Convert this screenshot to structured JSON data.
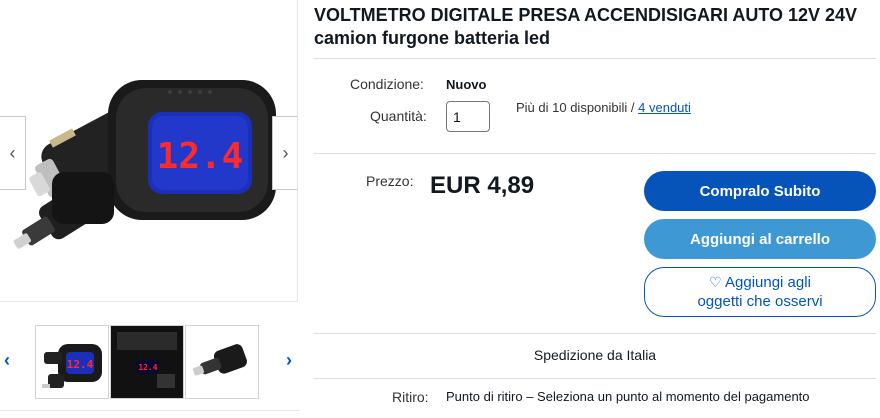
{
  "product": {
    "title": "VOLTMETRO DIGITALE PRESA ACCENDISIGARI AUTO 12V 24V camion furgone batteria led",
    "display_reading": "12.4"
  },
  "gallery": {
    "prev_icon": "‹",
    "next_icon": "›",
    "thumb_prev_icon": "‹",
    "thumb_next_icon": "›",
    "thumb_readings": [
      "12.4",
      "12.4"
    ]
  },
  "details": {
    "condition_label": "Condizione:",
    "condition_value": "Nuovo",
    "quantity_label": "Quantità:",
    "quantity_value": "1",
    "availability_text": "Più di 10 disponibili / ",
    "sold_link": "4 venduti",
    "price_label": "Prezzo:",
    "price_value": "EUR 4,89"
  },
  "buttons": {
    "buy_now": "Compralo Subito",
    "add_to_cart": "Aggiungi al carrello",
    "watch_heart": "♡",
    "watch_line1": "Aggiungi agli",
    "watch_line2": "oggetti che osservi"
  },
  "shipping": {
    "ships_from": "Spedizione da Italia",
    "pickup_label": "Ritiro:",
    "pickup_value": "Punto di ritiro – Seleziona un punto al momento del pagamento"
  },
  "colors": {
    "primary_blue": "#0654ba",
    "secondary_blue": "#3d98d3",
    "display_red": "#ff2a2a",
    "display_bg": "#1b2fb8"
  }
}
